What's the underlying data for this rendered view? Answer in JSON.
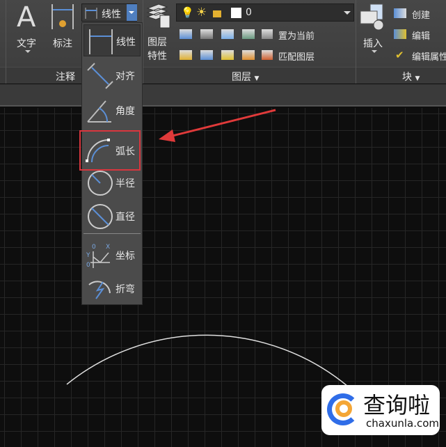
{
  "ribbon": {
    "text_label": "文字",
    "dim_label": "标注",
    "dim_style": "线性",
    "layer_props": [
      "图层",
      "特性"
    ],
    "layer_current": "0",
    "layer_set_current": "置为当前",
    "layer_match": "匹配图层",
    "insert_label": "插入",
    "create_label": "创建",
    "edit_label": "编辑",
    "edit_attr_label": "编辑属性",
    "panels": {
      "annotation": "注释",
      "layers": "图层",
      "block": "块"
    }
  },
  "dim_menu": {
    "items": [
      {
        "label": "线性",
        "icon": "linear-dim-icon",
        "selected": true
      },
      {
        "label": "对齐",
        "icon": "aligned-dim-icon"
      },
      {
        "label": "角度",
        "icon": "angular-dim-icon"
      },
      {
        "label": "弧长",
        "icon": "arc-length-dim-icon",
        "highlighted": true
      },
      {
        "label": "半径",
        "icon": "radius-dim-icon"
      },
      {
        "label": "直径",
        "icon": "diameter-dim-icon"
      },
      {
        "label": "坐标",
        "icon": "ordinate-dim-icon"
      },
      {
        "label": "折弯",
        "icon": "jogged-dim-icon"
      }
    ]
  },
  "colors": {
    "highlight_box": "#d9363e",
    "arrow": "#e03a3a",
    "accent_blue": "#5b8fd6"
  },
  "watermark": {
    "name": "查询啦",
    "url": "chaxunla.com"
  }
}
